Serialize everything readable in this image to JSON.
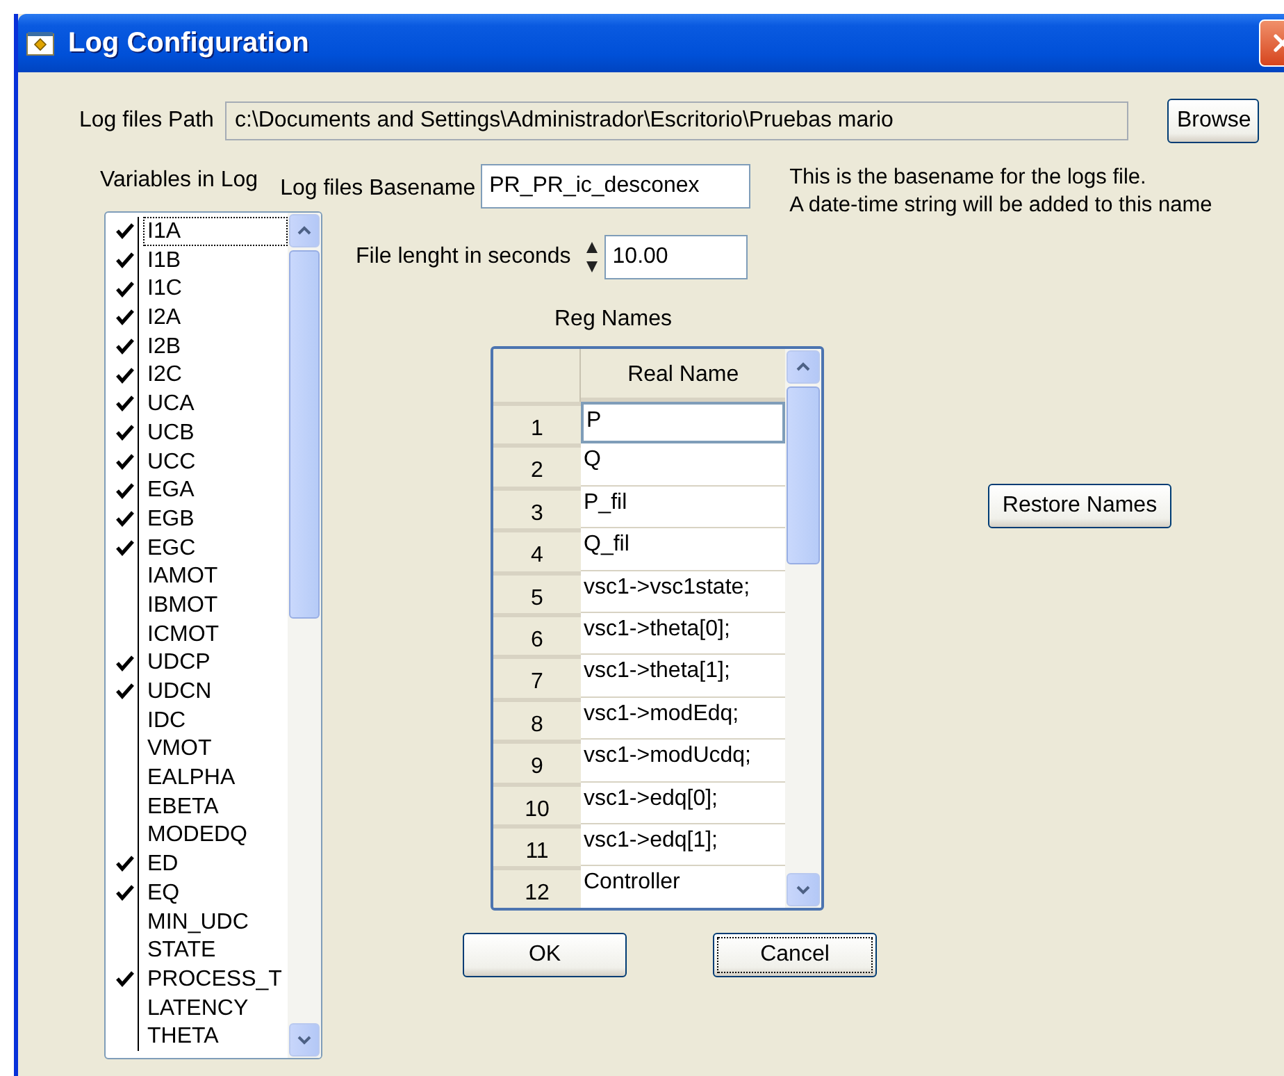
{
  "window": {
    "title": "Log Configuration"
  },
  "log_path": {
    "label": "Log files Path",
    "value": "c:\\Documents and Settings\\Administrador\\Escritorio\\Pruebas mario"
  },
  "browse_button": "Browse",
  "variables": {
    "label": "Variables in Log",
    "items": [
      {
        "name": "I1A",
        "checked": true,
        "selected": true
      },
      {
        "name": "I1B",
        "checked": true,
        "selected": false
      },
      {
        "name": "I1C",
        "checked": true,
        "selected": false
      },
      {
        "name": "I2A",
        "checked": true,
        "selected": false
      },
      {
        "name": "I2B",
        "checked": true,
        "selected": false
      },
      {
        "name": "I2C",
        "checked": true,
        "selected": false
      },
      {
        "name": "UCA",
        "checked": true,
        "selected": false
      },
      {
        "name": "UCB",
        "checked": true,
        "selected": false
      },
      {
        "name": "UCC",
        "checked": true,
        "selected": false
      },
      {
        "name": "EGA",
        "checked": true,
        "selected": false
      },
      {
        "name": "EGB",
        "checked": true,
        "selected": false
      },
      {
        "name": "EGC",
        "checked": true,
        "selected": false
      },
      {
        "name": "IAMOT",
        "checked": false,
        "selected": false
      },
      {
        "name": "IBMOT",
        "checked": false,
        "selected": false
      },
      {
        "name": "ICMOT",
        "checked": false,
        "selected": false
      },
      {
        "name": "UDCP",
        "checked": true,
        "selected": false
      },
      {
        "name": "UDCN",
        "checked": true,
        "selected": false
      },
      {
        "name": "IDC",
        "checked": false,
        "selected": false
      },
      {
        "name": "VMOT",
        "checked": false,
        "selected": false
      },
      {
        "name": "EALPHA",
        "checked": false,
        "selected": false
      },
      {
        "name": "EBETA",
        "checked": false,
        "selected": false
      },
      {
        "name": "MODEDQ",
        "checked": false,
        "selected": false
      },
      {
        "name": "ED",
        "checked": true,
        "selected": false
      },
      {
        "name": "EQ",
        "checked": true,
        "selected": false
      },
      {
        "name": "MIN_UDC",
        "checked": false,
        "selected": false
      },
      {
        "name": "STATE",
        "checked": false,
        "selected": false
      },
      {
        "name": "PROCESS_T",
        "checked": true,
        "selected": false
      },
      {
        "name": "LATENCY",
        "checked": false,
        "selected": false
      },
      {
        "name": "THETA",
        "checked": false,
        "selected": false
      }
    ]
  },
  "basename": {
    "label": "Log files Basename",
    "value": "PR_PR_ic_desconex"
  },
  "basename_help": [
    "This is the basename for the logs file.",
    "A date-time string will be added to this name"
  ],
  "file_length": {
    "label": "File lenght in seconds",
    "value": "10.00"
  },
  "reg_names": {
    "title": "Reg Names",
    "columns": [
      "Real Name"
    ],
    "rows": [
      {
        "number": "1",
        "name": "P",
        "selected": true
      },
      {
        "number": "2",
        "name": "Q",
        "selected": false
      },
      {
        "number": "3",
        "name": "P_fil",
        "selected": false
      },
      {
        "number": "4",
        "name": "Q_fil",
        "selected": false
      },
      {
        "number": "5",
        "name": "vsc1->vsc1state;",
        "selected": false
      },
      {
        "number": "6",
        "name": "vsc1->theta[0];",
        "selected": false
      },
      {
        "number": "7",
        "name": "vsc1->theta[1];",
        "selected": false
      },
      {
        "number": "8",
        "name": "vsc1->modEdq;",
        "selected": false
      },
      {
        "number": "9",
        "name": "vsc1->modUcdq;",
        "selected": false
      },
      {
        "number": "10",
        "name": "vsc1->edq[0];",
        "selected": false
      },
      {
        "number": "11",
        "name": "vsc1->edq[1];",
        "selected": false
      },
      {
        "number": "12",
        "name": "Controller",
        "selected": false
      }
    ]
  },
  "restore_button": "Restore Names",
  "buttons": [
    {
      "label": "OK",
      "focused": false
    },
    {
      "label": "Cancel",
      "focused": true
    }
  ]
}
